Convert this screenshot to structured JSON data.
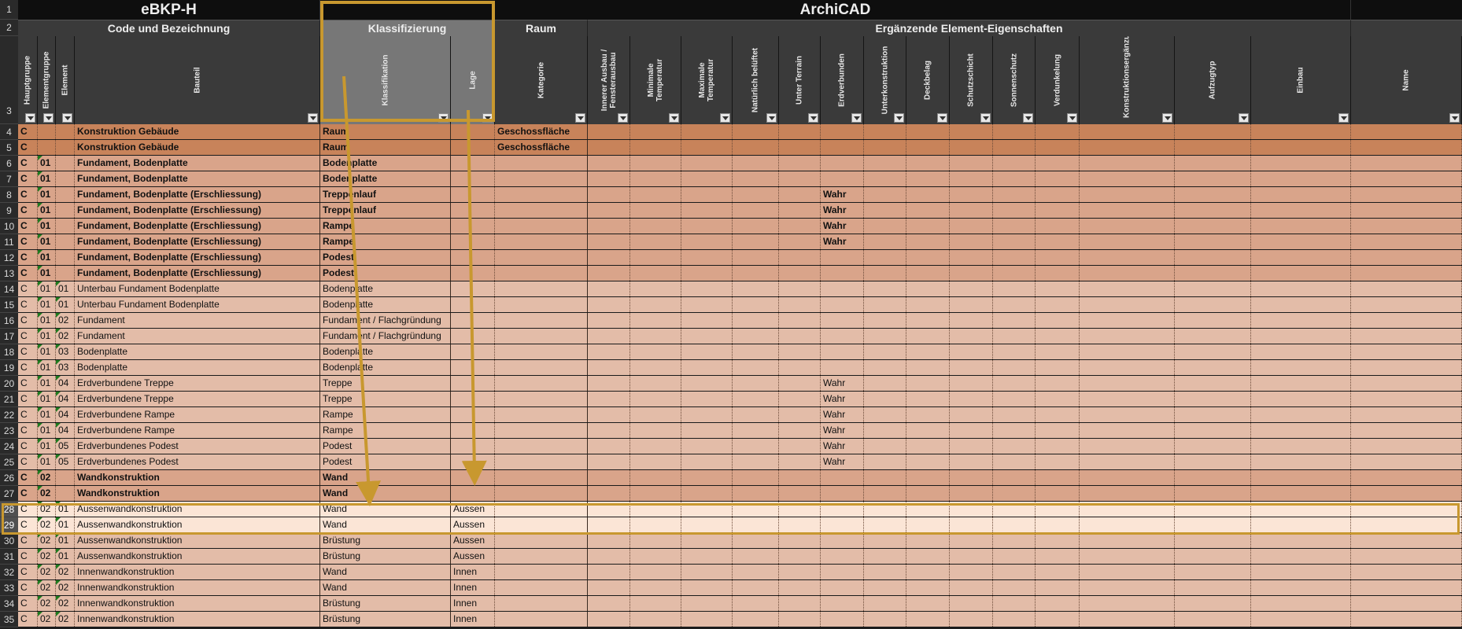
{
  "header_groups": [
    {
      "label": "eBKP-H"
    },
    {
      "label": "ArchiCAD"
    }
  ],
  "sub_groups": [
    {
      "label": "Code und Bezeichnung"
    },
    {
      "label": "Klassifizierung"
    },
    {
      "label": "Raum"
    },
    {
      "label": "Ergänzende Element-Eigenschaften"
    }
  ],
  "columns": [
    {
      "label": "Hauptgruppe"
    },
    {
      "label": "Elementgruppe"
    },
    {
      "label": "Element"
    },
    {
      "label": "Bauteil"
    },
    {
      "label": "Klassifikation"
    },
    {
      "label": "Lage"
    },
    {
      "label": "Kategorie"
    },
    {
      "label": "Innerer Ausbau / Fensterausbau"
    },
    {
      "label": "Minimale Temperatur"
    },
    {
      "label": "Maximale Temperatur"
    },
    {
      "label": "Natürlich belüftet"
    },
    {
      "label": "Unter Terrain"
    },
    {
      "label": "Erdverbunden"
    },
    {
      "label": "Unterkonstruktion"
    },
    {
      "label": "Deckbelag"
    },
    {
      "label": "Schutzschicht"
    },
    {
      "label": "Sonnenschutz"
    },
    {
      "label": "Verdunkelung"
    },
    {
      "label": "Konstruktionsergänzung"
    },
    {
      "label": "Aufzugtyp"
    },
    {
      "label": "Einbau"
    },
    {
      "label": "Name"
    }
  ],
  "row_headers": [
    "1",
    "2",
    "3"
  ],
  "rows": [
    {
      "num": "4",
      "hg": "C",
      "eg": "",
      "el": "",
      "bauteil": "Konstruktion Gebäude",
      "klass": "Raum",
      "lage": "",
      "kat": "Geschossfläche",
      "erd": "",
      "bold": true,
      "color": "#c8835a"
    },
    {
      "num": "5",
      "hg": "C",
      "eg": "",
      "el": "",
      "bauteil": "Konstruktion Gebäude",
      "klass": "Raum",
      "lage": "",
      "kat": "Geschossfläche",
      "erd": "",
      "bold": true,
      "color": "#c8835a"
    },
    {
      "num": "6",
      "hg": "C",
      "eg": "01",
      "el": "",
      "bauteil": "Fundament, Bodenplatte",
      "klass": "Bodenplatte",
      "lage": "",
      "kat": "",
      "erd": "",
      "bold": true,
      "color": "#d9a48a"
    },
    {
      "num": "7",
      "hg": "C",
      "eg": "01",
      "el": "",
      "bauteil": "Fundament, Bodenplatte",
      "klass": "Bodenplatte",
      "lage": "",
      "kat": "",
      "erd": "",
      "bold": true,
      "color": "#d9a48a"
    },
    {
      "num": "8",
      "hg": "C",
      "eg": "01",
      "el": "",
      "bauteil": "Fundament, Bodenplatte (Erschliessung)",
      "klass": "Treppenlauf",
      "lage": "",
      "kat": "",
      "erd": "Wahr",
      "bold": true,
      "color": "#d9a48a"
    },
    {
      "num": "9",
      "hg": "C",
      "eg": "01",
      "el": "",
      "bauteil": "Fundament, Bodenplatte (Erschliessung)",
      "klass": "Treppenlauf",
      "lage": "",
      "kat": "",
      "erd": "Wahr",
      "bold": true,
      "color": "#d9a48a"
    },
    {
      "num": "10",
      "hg": "C",
      "eg": "01",
      "el": "",
      "bauteil": "Fundament, Bodenplatte (Erschliessung)",
      "klass": "Rampe",
      "lage": "",
      "kat": "",
      "erd": "Wahr",
      "bold": true,
      "color": "#d9a48a"
    },
    {
      "num": "11",
      "hg": "C",
      "eg": "01",
      "el": "",
      "bauteil": "Fundament, Bodenplatte (Erschliessung)",
      "klass": "Rampe",
      "lage": "",
      "kat": "",
      "erd": "Wahr",
      "bold": true,
      "color": "#d9a48a"
    },
    {
      "num": "12",
      "hg": "C",
      "eg": "01",
      "el": "",
      "bauteil": "Fundament, Bodenplatte (Erschliessung)",
      "klass": "Podest",
      "lage": "",
      "kat": "",
      "erd": "",
      "bold": true,
      "color": "#d9a48a"
    },
    {
      "num": "13",
      "hg": "C",
      "eg": "01",
      "el": "",
      "bauteil": "Fundament, Bodenplatte (Erschliessung)",
      "klass": "Podest",
      "lage": "",
      "kat": "",
      "erd": "",
      "bold": true,
      "color": "#d9a48a"
    },
    {
      "num": "14",
      "hg": "C",
      "eg": "01",
      "el": "01",
      "bauteil": "Unterbau Fundament Bodenplatte",
      "klass": "Bodenplatte",
      "lage": "",
      "kat": "",
      "erd": "",
      "bold": false,
      "color": "#e3bca8"
    },
    {
      "num": "15",
      "hg": "C",
      "eg": "01",
      "el": "01",
      "bauteil": "Unterbau Fundament Bodenplatte",
      "klass": "Bodenplatte",
      "lage": "",
      "kat": "",
      "erd": "",
      "bold": false,
      "color": "#e3bca8"
    },
    {
      "num": "16",
      "hg": "C",
      "eg": "01",
      "el": "02",
      "bauteil": "Fundament",
      "klass": "Fundament / Flachgründung",
      "lage": "",
      "kat": "",
      "erd": "",
      "bold": false,
      "color": "#e3bca8"
    },
    {
      "num": "17",
      "hg": "C",
      "eg": "01",
      "el": "02",
      "bauteil": "Fundament",
      "klass": "Fundament / Flachgründung",
      "lage": "",
      "kat": "",
      "erd": "",
      "bold": false,
      "color": "#e3bca8"
    },
    {
      "num": "18",
      "hg": "C",
      "eg": "01",
      "el": "03",
      "bauteil": "Bodenplatte",
      "klass": "Bodenplatte",
      "lage": "",
      "kat": "",
      "erd": "",
      "bold": false,
      "color": "#e3bca8"
    },
    {
      "num": "19",
      "hg": "C",
      "eg": "01",
      "el": "03",
      "bauteil": "Bodenplatte",
      "klass": "Bodenplatte",
      "lage": "",
      "kat": "",
      "erd": "",
      "bold": false,
      "color": "#e3bca8"
    },
    {
      "num": "20",
      "hg": "C",
      "eg": "01",
      "el": "04",
      "bauteil": "Erdverbundene Treppe",
      "klass": "Treppe",
      "lage": "",
      "kat": "",
      "erd": "Wahr",
      "bold": false,
      "color": "#e3bca8"
    },
    {
      "num": "21",
      "hg": "C",
      "eg": "01",
      "el": "04",
      "bauteil": "Erdverbundene Treppe",
      "klass": "Treppe",
      "lage": "",
      "kat": "",
      "erd": "Wahr",
      "bold": false,
      "color": "#e3bca8"
    },
    {
      "num": "22",
      "hg": "C",
      "eg": "01",
      "el": "04",
      "bauteil": "Erdverbundene Rampe",
      "klass": "Rampe",
      "lage": "",
      "kat": "",
      "erd": "Wahr",
      "bold": false,
      "color": "#e3bca8"
    },
    {
      "num": "23",
      "hg": "C",
      "eg": "01",
      "el": "04",
      "bauteil": "Erdverbundene Rampe",
      "klass": "Rampe",
      "lage": "",
      "kat": "",
      "erd": "Wahr",
      "bold": false,
      "color": "#e3bca8"
    },
    {
      "num": "24",
      "hg": "C",
      "eg": "01",
      "el": "05",
      "bauteil": "Erdverbundenes Podest",
      "klass": "Podest",
      "lage": "",
      "kat": "",
      "erd": "Wahr",
      "bold": false,
      "color": "#e3bca8"
    },
    {
      "num": "25",
      "hg": "C",
      "eg": "01",
      "el": "05",
      "bauteil": "Erdverbundenes Podest",
      "klass": "Podest",
      "lage": "",
      "kat": "",
      "erd": "Wahr",
      "bold": false,
      "color": "#e3bca8"
    },
    {
      "num": "26",
      "hg": "C",
      "eg": "02",
      "el": "",
      "bauteil": "Wandkonstruktion",
      "klass": "Wand",
      "lage": "",
      "kat": "",
      "erd": "",
      "bold": true,
      "color": "#d9a48a"
    },
    {
      "num": "27",
      "hg": "C",
      "eg": "02",
      "el": "",
      "bauteil": "Wandkonstruktion",
      "klass": "Wand",
      "lage": "",
      "kat": "",
      "erd": "",
      "bold": true,
      "color": "#d9a48a"
    },
    {
      "num": "28",
      "hg": "C",
      "eg": "02",
      "el": "01",
      "bauteil": "Aussenwandkonstruktion",
      "klass": "Wand",
      "lage": "Aussen",
      "kat": "",
      "erd": "",
      "bold": false,
      "color": "#fbe5d6"
    },
    {
      "num": "29",
      "hg": "C",
      "eg": "02",
      "el": "01",
      "bauteil": "Aussenwandkonstruktion",
      "klass": "Wand",
      "lage": "Aussen",
      "kat": "",
      "erd": "",
      "bold": false,
      "color": "#fbe5d6"
    },
    {
      "num": "30",
      "hg": "C",
      "eg": "02",
      "el": "01",
      "bauteil": "Aussenwandkonstruktion",
      "klass": "Brüstung",
      "lage": "Aussen",
      "kat": "",
      "erd": "",
      "bold": false,
      "color": "#e3bca8"
    },
    {
      "num": "31",
      "hg": "C",
      "eg": "02",
      "el": "01",
      "bauteil": "Aussenwandkonstruktion",
      "klass": "Brüstung",
      "lage": "Aussen",
      "kat": "",
      "erd": "",
      "bold": false,
      "color": "#e3bca8"
    },
    {
      "num": "32",
      "hg": "C",
      "eg": "02",
      "el": "02",
      "bauteil": "Innenwandkonstruktion",
      "klass": "Wand",
      "lage": "Innen",
      "kat": "",
      "erd": "",
      "bold": false,
      "color": "#e3bca8"
    },
    {
      "num": "33",
      "hg": "C",
      "eg": "02",
      "el": "02",
      "bauteil": "Innenwandkonstruktion",
      "klass": "Wand",
      "lage": "Innen",
      "kat": "",
      "erd": "",
      "bold": false,
      "color": "#e3bca8"
    },
    {
      "num": "34",
      "hg": "C",
      "eg": "02",
      "el": "02",
      "bauteil": "Innenwandkonstruktion",
      "klass": "Brüstung",
      "lage": "Innen",
      "kat": "",
      "erd": "",
      "bold": false,
      "color": "#e3bca8"
    },
    {
      "num": "35",
      "hg": "C",
      "eg": "02",
      "el": "02",
      "bauteil": "Innenwandkonstruktion",
      "klass": "Brüstung",
      "lage": "Innen",
      "kat": "",
      "erd": "",
      "bold": false,
      "color": "#e3bca8"
    }
  ],
  "colors": {
    "highlight": "#c8982f",
    "group_row": "#c8835a",
    "bold_row": "#d9a48a",
    "detail_row": "#e3bca8",
    "selected_row": "#fbe5d6"
  }
}
